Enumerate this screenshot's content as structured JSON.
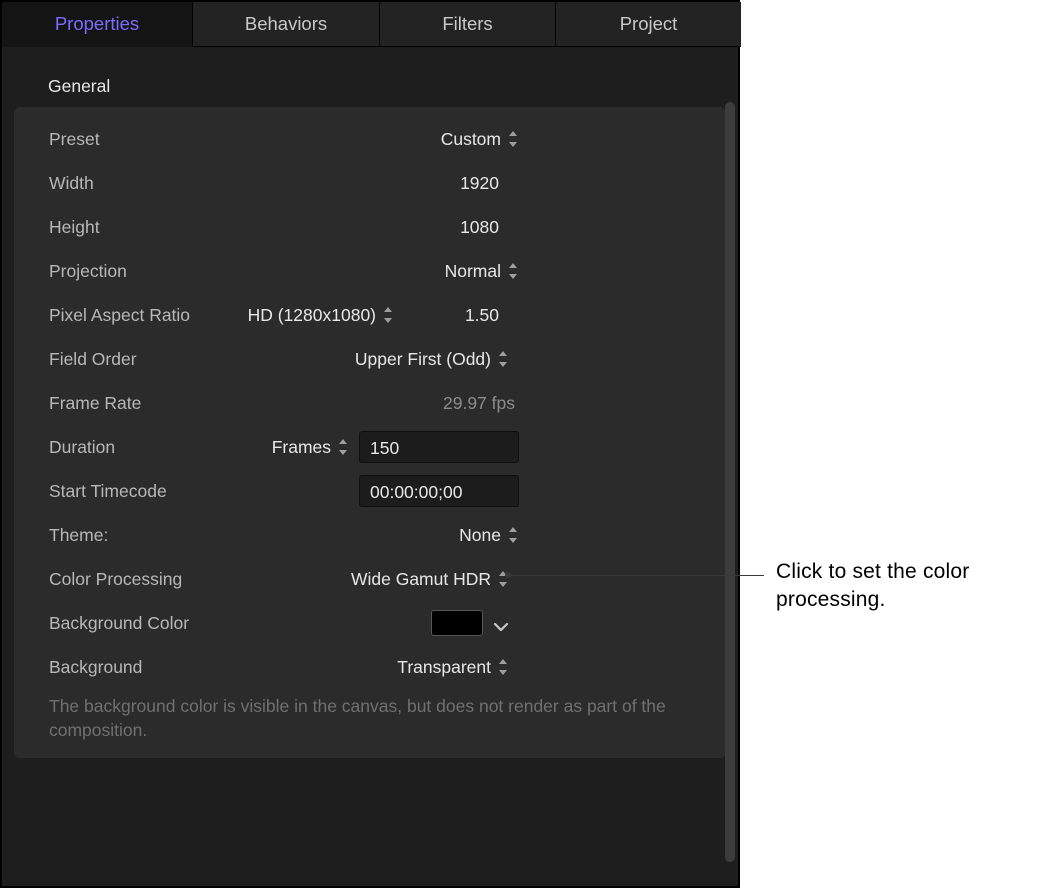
{
  "tabs": {
    "properties": "Properties",
    "behaviors": "Behaviors",
    "filters": "Filters",
    "project": "Project"
  },
  "group_title": "General",
  "rows": {
    "preset": {
      "label": "Preset",
      "value": "Custom"
    },
    "width": {
      "label": "Width",
      "value": "1920"
    },
    "height": {
      "label": "Height",
      "value": "1080"
    },
    "projection": {
      "label": "Projection",
      "value": "Normal"
    },
    "par": {
      "label": "Pixel Aspect Ratio",
      "value": "HD (1280x1080)",
      "numeric": "1.50"
    },
    "field_order": {
      "label": "Field Order",
      "value": "Upper First (Odd)"
    },
    "frame_rate": {
      "label": "Frame Rate",
      "value": "29.97 fps"
    },
    "duration": {
      "label": "Duration",
      "unit": "Frames",
      "value": "150"
    },
    "start_tc": {
      "label": "Start Timecode",
      "value": "00:00:00;00"
    },
    "theme": {
      "label": "Theme:",
      "value": "None"
    },
    "color_processing": {
      "label": "Color Processing",
      "value": "Wide Gamut HDR"
    },
    "bg_color": {
      "label": "Background Color",
      "swatch": "#000000"
    },
    "background": {
      "label": "Background",
      "value": "Transparent"
    }
  },
  "hint_text": "The background color is visible in the canvas, but does not render as part of the composition.",
  "callout_text": "Click to set the color processing."
}
